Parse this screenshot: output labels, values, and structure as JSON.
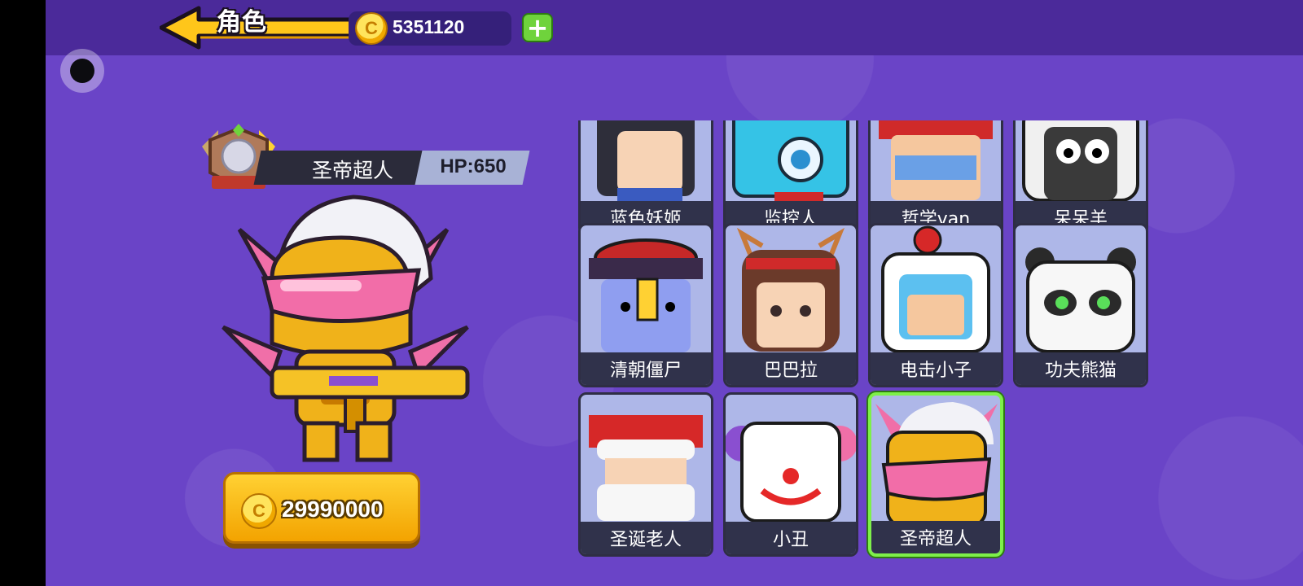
{
  "header": {
    "title": "角色",
    "coins": "5351120",
    "add_label": "+"
  },
  "hero": {
    "name": "圣帝超人",
    "hp_text": "HP:650",
    "price": "29990000"
  },
  "characters": [
    {
      "name": "蓝色妖姬"
    },
    {
      "name": "监控人"
    },
    {
      "name": "哲学van"
    },
    {
      "name": "呆呆羊"
    },
    {
      "name": "清朝僵尸"
    },
    {
      "name": "巴巴拉"
    },
    {
      "name": "电击小子"
    },
    {
      "name": "功夫熊猫"
    },
    {
      "name": "圣诞老人"
    },
    {
      "name": "小丑"
    },
    {
      "name": "圣帝超人",
      "selected": true
    }
  ],
  "colors": {
    "background": "#6a44c7",
    "topbar": "#4b2a9a",
    "selected": "#7ef04a",
    "gold": "#ffd133"
  }
}
